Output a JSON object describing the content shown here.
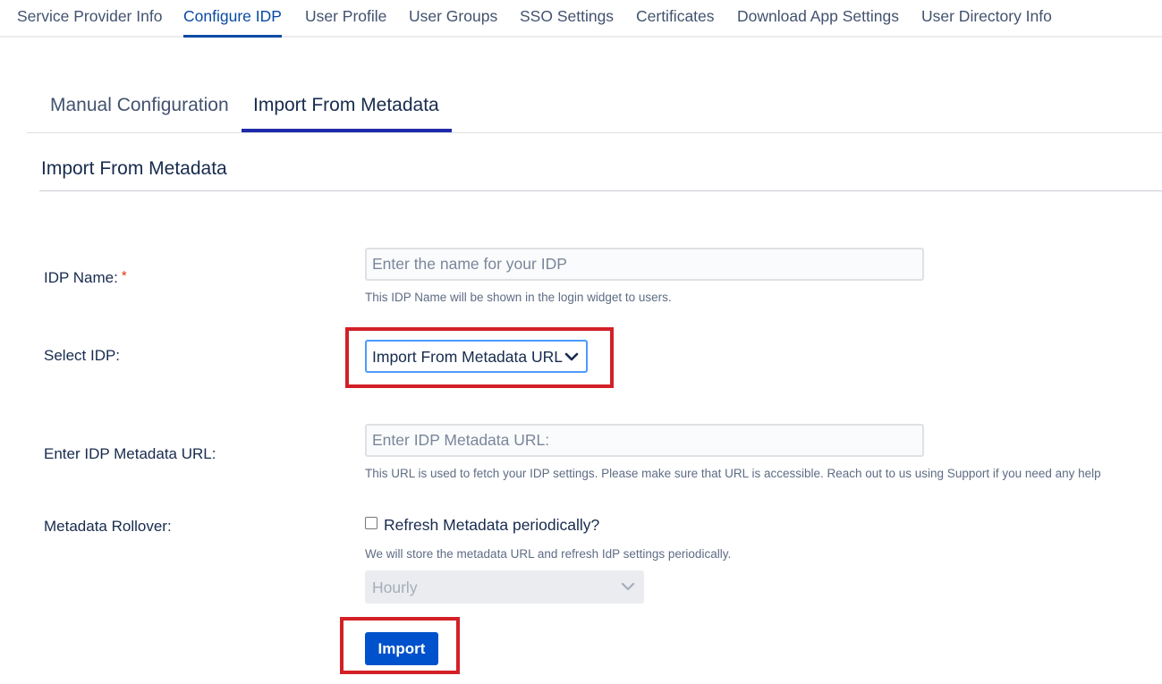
{
  "top_nav": {
    "items": [
      {
        "label": "Service Provider Info",
        "active": false
      },
      {
        "label": "Configure IDP",
        "active": true
      },
      {
        "label": "User Profile",
        "active": false
      },
      {
        "label": "User Groups",
        "active": false
      },
      {
        "label": "SSO Settings",
        "active": false
      },
      {
        "label": "Certificates",
        "active": false
      },
      {
        "label": "Download App Settings",
        "active": false
      },
      {
        "label": "User Directory Info",
        "active": false
      }
    ]
  },
  "sub_tabs": [
    {
      "label": "Manual Configuration",
      "active": false
    },
    {
      "label": "Import From Metadata",
      "active": true
    }
  ],
  "section_title": "Import From Metadata",
  "form": {
    "idp_name": {
      "label": "IDP Name:",
      "required_marker": "*",
      "value": "",
      "placeholder": "Enter the name for your IDP",
      "help": "This IDP Name will be shown in the login widget to users."
    },
    "select_idp": {
      "label": "Select IDP:",
      "selected": "Import From Metadata URL"
    },
    "metadata_url": {
      "label": "Enter IDP Metadata URL:",
      "value": "",
      "placeholder": "Enter IDP Metadata URL:",
      "help": "This URL is used to fetch your IDP settings. Please make sure that URL is accessible. Reach out to us using Support if you need any help"
    },
    "rollover": {
      "label": "Metadata Rollover:",
      "checkbox_label": "Refresh Metadata periodically?",
      "checked": false,
      "help": "We will store the metadata URL and refresh IdP settings periodically.",
      "interval": "Hourly",
      "interval_disabled": true
    },
    "import_button": "Import"
  },
  "colors": {
    "accent": "#0052cc",
    "active_tab": "#0a4aa3",
    "highlight_box": "#d32027",
    "required": "#de350b"
  },
  "icons": {
    "select_chevron": "chevron-down-icon",
    "interval_chevron": "chevron-down-icon"
  }
}
